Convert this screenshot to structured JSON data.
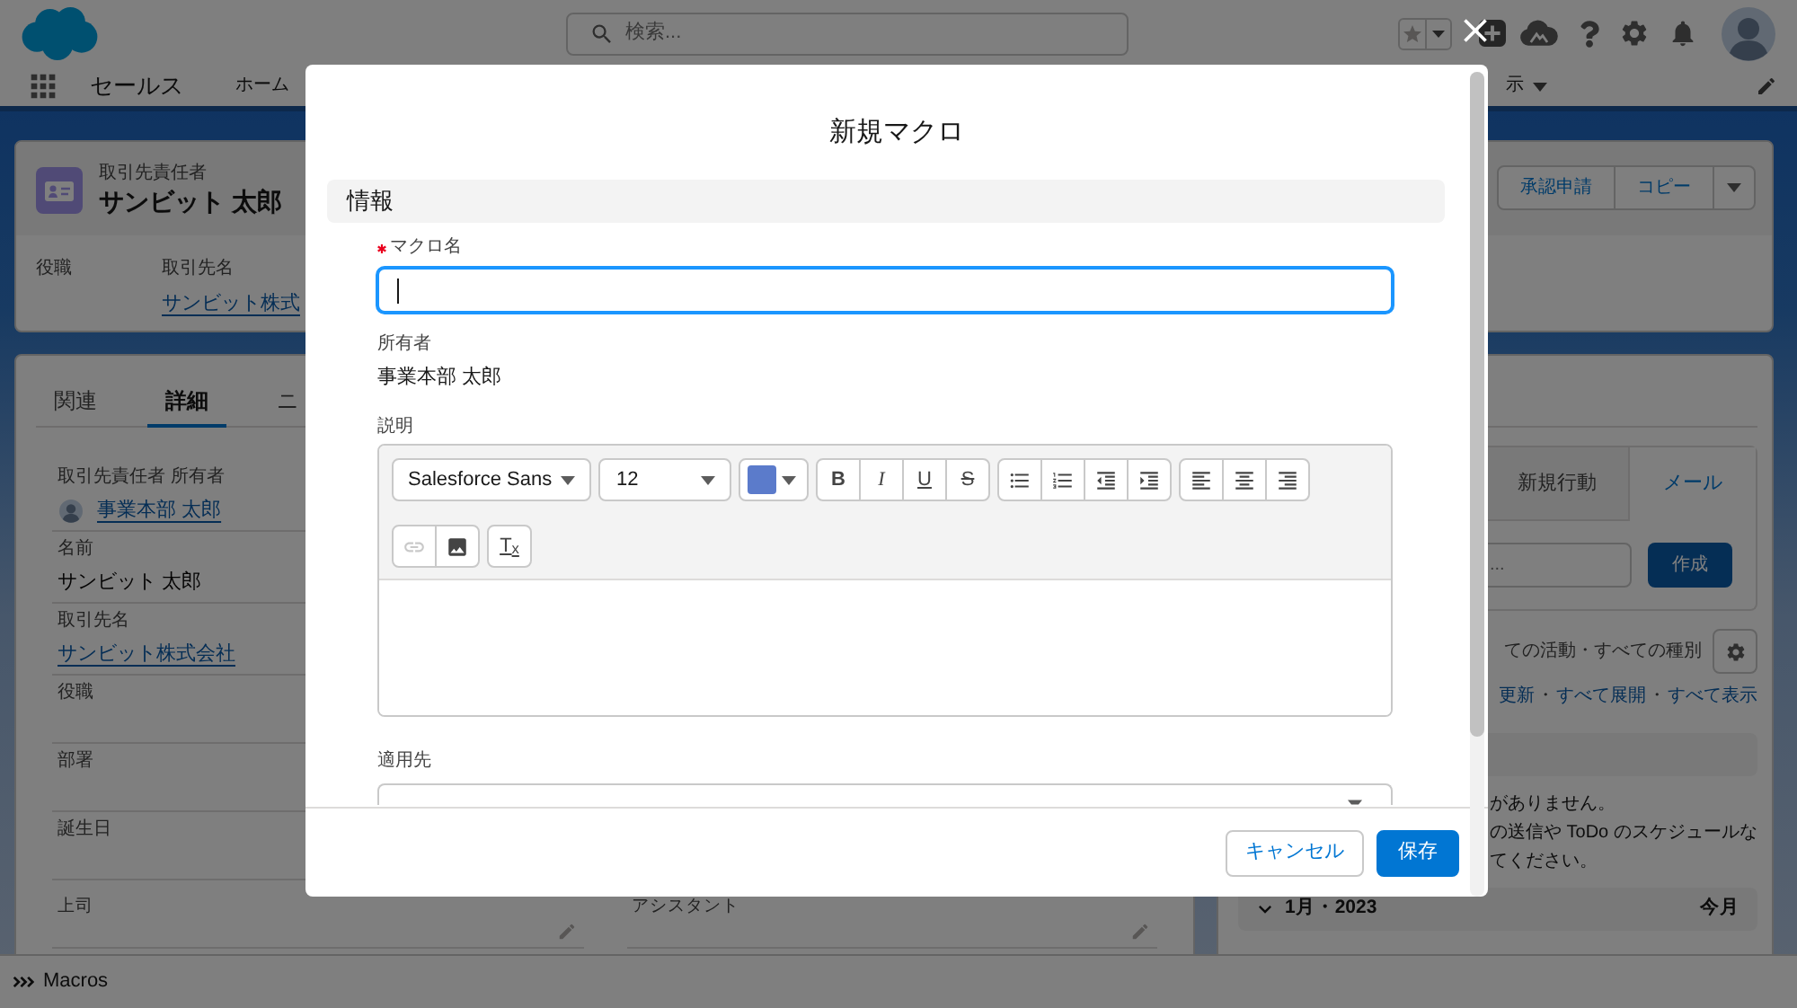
{
  "header": {
    "search_placeholder": "検索..."
  },
  "nav": {
    "app_name": "セールス",
    "items": [
      {
        "label": "ホーム",
        "has_menu": false
      },
      {
        "label": "示",
        "has_menu": true
      }
    ]
  },
  "record": {
    "object_label": "取引先責任者",
    "name": "サンビット 太郎",
    "actions": [
      "承認申請",
      "コピー"
    ],
    "fields": [
      {
        "label": "役職"
      },
      {
        "label": "取引先名",
        "value": "サンビット株式"
      }
    ]
  },
  "detail": {
    "tabs": [
      {
        "label": "関連",
        "selected": false
      },
      {
        "label": "詳細",
        "selected": true
      },
      {
        "label": "ニ",
        "selected": false
      }
    ],
    "fields": [
      {
        "label": "取引先責任者 所有者",
        "kind": "user",
        "value": "事業本部 太郎"
      },
      {
        "label": "名前",
        "kind": "text",
        "value": "サンビット 太郎"
      },
      {
        "label": "取引先名",
        "kind": "link",
        "value": "サンビット株式会社"
      },
      {
        "label": "役職",
        "kind": "empty"
      },
      {
        "label": "部署",
        "kind": "empty"
      },
      {
        "label": "誕生日",
        "kind": "empty"
      }
    ],
    "last_row": [
      {
        "label": "上司"
      },
      {
        "label": "アシスタント"
      }
    ]
  },
  "activity": {
    "tabs": [
      {
        "label": "新規行動",
        "selected": false
      },
      {
        "label": "メール",
        "selected": true
      }
    ],
    "composer": {
      "placeholder": "...",
      "button": "作成"
    },
    "filter": "ての活動・すべての種別",
    "links": [
      {
        "kind": "link",
        "label": "更新"
      },
      {
        "kind": "separator",
        "label": "・"
      },
      {
        "kind": "link",
        "label": "すべて展開"
      },
      {
        "kind": "separator",
        "label": "・"
      },
      {
        "kind": "link",
        "label": "すべて表示"
      }
    ],
    "empty_message_lines": [
      "がありません。",
      "の送信や ToDo のスケジュールな",
      "てください。"
    ],
    "month": {
      "label": "1月・2023",
      "expanded": true,
      "link": "今月"
    }
  },
  "utility_bar": {
    "items": [
      {
        "label": "Macros"
      }
    ]
  },
  "modal": {
    "title": "新規マクロ",
    "section": "情報",
    "fields": [
      {
        "kind": "text",
        "label": "マクロ名",
        "required": true,
        "focused": true
      },
      {
        "kind": "readonly",
        "label": "所有者",
        "required": false,
        "value": "事業本部 太郎"
      },
      {
        "kind": "richtext",
        "label": "説明",
        "required": false,
        "toolbar": {
          "font": "Salesforce Sans",
          "size": "12",
          "color": "#5b7bcb",
          "rows": [
            [
              [
                {
                  "kind": "bold",
                  "label": "B",
                  "disabled": false
                },
                {
                  "kind": "italic",
                  "label": "I",
                  "disabled": false
                },
                {
                  "kind": "underline",
                  "label": "U",
                  "disabled": false
                },
                {
                  "kind": "strike",
                  "label": "S",
                  "disabled": false
                }
              ],
              [
                {
                  "kind": "bullets",
                  "disabled": false
                },
                {
                  "kind": "numbers",
                  "disabled": false
                },
                {
                  "kind": "outdent",
                  "disabled": false
                },
                {
                  "kind": "indent",
                  "disabled": false
                }
              ],
              [
                {
                  "kind": "align_left",
                  "disabled": false
                },
                {
                  "kind": "align_center",
                  "disabled": false
                },
                {
                  "kind": "align_right",
                  "disabled": false
                }
              ]
            ],
            [
              [
                {
                  "kind": "link",
                  "disabled": true
                },
                {
                  "kind": "image",
                  "disabled": false
                }
              ],
              [
                {
                  "kind": "clear",
                  "label": "T$_{x}$",
                  "disabled": false
                }
              ]
            ]
          ]
        }
      },
      {
        "kind": "select",
        "label": "適用先",
        "required": false
      }
    ],
    "buttons": [
      {
        "label": "キャンセル",
        "kind": "neutral"
      },
      {
        "label": "保存",
        "kind": "brand"
      }
    ]
  }
}
